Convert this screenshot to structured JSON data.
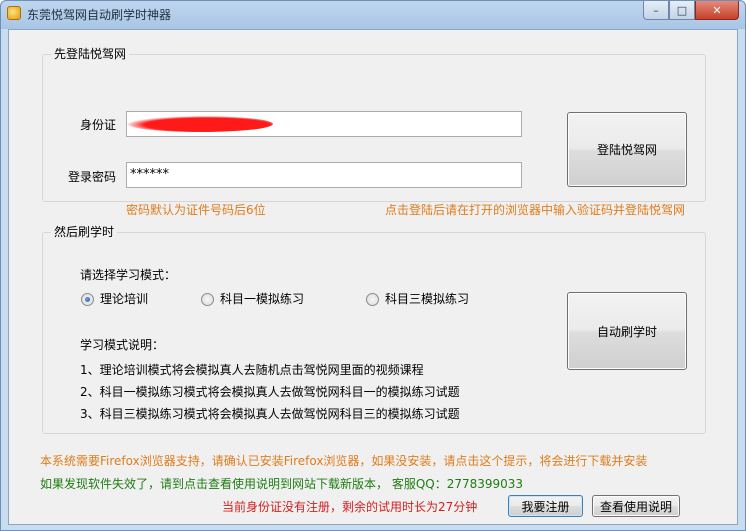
{
  "window": {
    "title": "东莞悦驾网自动刷学时神器",
    "min_label": "–",
    "max_label": "□",
    "close_label": "✕"
  },
  "login_group": {
    "title": "先登陆悦驾网",
    "id_label": "身份证",
    "password_label": "登录密码",
    "password_value": "******",
    "hint_password": "密码默认为证件号码后6位",
    "hint_captcha": "点击登陆后请在打开的浏览器中输入验证码并登陆悦驾网",
    "login_button": "登陆悦驾网"
  },
  "study_group": {
    "title": "然后刷学时",
    "mode_prompt": "请选择学习模式：",
    "modes": [
      {
        "label": "理论培训",
        "checked": true
      },
      {
        "label": "科目一模拟练习",
        "checked": false
      },
      {
        "label": "科目三模拟练习",
        "checked": false
      }
    ],
    "desc_title": "学习模式说明：",
    "desc_lines": [
      "1、理论培训模式将会模拟真人去随机点击驾悦网里面的视频课程",
      "2、科目一模拟练习模式将会模拟真人去做驾悦网科目一的模拟练习试题",
      "3、科目三模拟练习模式将会模拟真人去做驾悦网科目三的模拟练习试题"
    ],
    "auto_button": "自动刷学时"
  },
  "footer": {
    "firefox_notice": "本系统需要Firefox浏览器支持，请确认已安装Firefox浏览器，如果没安装，请点击这个提示，将会进行下载并安装",
    "invalid_notice": "如果发现软件失效了，请到点击查看使用说明到网站下载新版本，   客服QQ：2778399033",
    "trial_notice": "当前身份证没有注册，剩余的试用时长为27分钟",
    "register_button": "我要注册",
    "help_button": "查看使用说明"
  },
  "colors": {
    "orange": "#e07c1b",
    "green": "#1f7d12",
    "red": "#d31f1f",
    "redaction": "#ff1a1a"
  }
}
